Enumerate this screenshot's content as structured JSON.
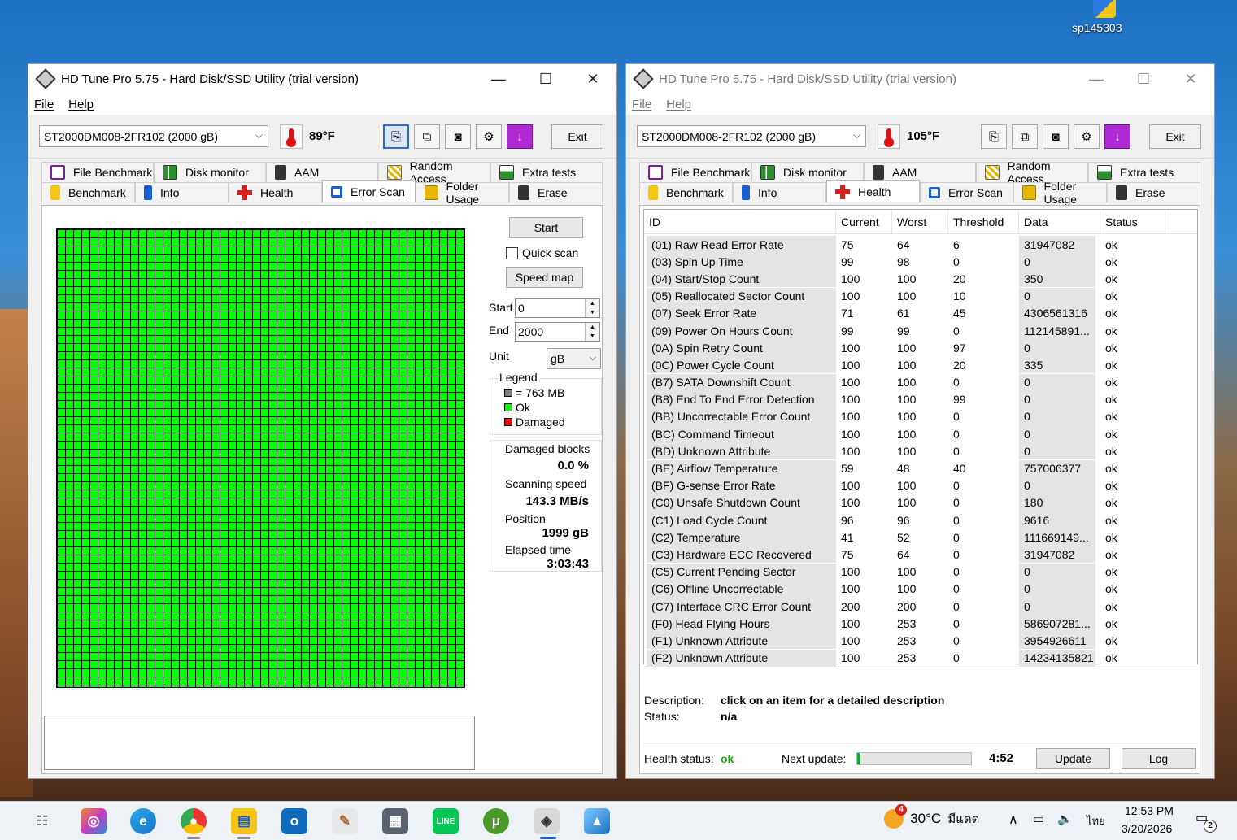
{
  "desktop": {
    "icon_label": "sp145303"
  },
  "left_window": {
    "title": "HD Tune Pro 5.75 - Hard Disk/SSD Utility (trial version)",
    "menu": [
      "File",
      "Help"
    ],
    "drive": "ST2000DM008-2FR102 (2000 gB)",
    "temperature": "89°F",
    "exit_label": "Exit",
    "tabs_row1": [
      "File Benchmark",
      "Disk monitor",
      "AAM",
      "Random Access",
      "Extra tests"
    ],
    "tabs_row2": [
      "Benchmark",
      "Info",
      "Health",
      "Error Scan",
      "Folder Usage",
      "Erase"
    ],
    "active_tab": "Error Scan",
    "error_scan": {
      "start_button": "Start",
      "quick_scan_label": "Quick scan",
      "speed_map_button": "Speed map",
      "start_label": "Start",
      "start_value": "0",
      "end_label": "End",
      "end_value": "2000",
      "unit_label": "Unit",
      "unit_value": "gB",
      "legend_title": "Legend",
      "legend_block": "= 763 MB",
      "legend_ok": "Ok",
      "legend_damaged": "Damaged",
      "damaged_blocks_label": "Damaged blocks",
      "damaged_blocks_value": "0.0 %",
      "scanning_speed_label": "Scanning speed",
      "scanning_speed_value": "143.3 MB/s",
      "position_label": "Position",
      "position_value": "1999 gB",
      "elapsed_label": "Elapsed time",
      "elapsed_value": "3:03:43"
    }
  },
  "right_window": {
    "title": "HD Tune Pro 5.75 - Hard Disk/SSD Utility (trial version)",
    "menu": [
      "File",
      "Help"
    ],
    "drive": "ST2000DM008-2FR102 (2000 gB)",
    "temperature": "105°F",
    "exit_label": "Exit",
    "tabs_row1": [
      "File Benchmark",
      "Disk monitor",
      "AAM",
      "Random Access",
      "Extra tests"
    ],
    "tabs_row2": [
      "Benchmark",
      "Info",
      "Health",
      "Error Scan",
      "Folder Usage",
      "Erase"
    ],
    "active_tab": "Health",
    "health": {
      "columns": [
        "ID",
        "Current",
        "Worst",
        "Threshold",
        "Data",
        "Status"
      ],
      "rows": [
        [
          "(01) Raw Read Error Rate",
          "75",
          "64",
          "6",
          "31947082",
          "ok"
        ],
        [
          "(03) Spin Up Time",
          "99",
          "98",
          "0",
          "0",
          "ok"
        ],
        [
          "(04) Start/Stop Count",
          "100",
          "100",
          "20",
          "350",
          "ok"
        ],
        [
          "(05) Reallocated Sector Count",
          "100",
          "100",
          "10",
          "0",
          "ok"
        ],
        [
          "(07) Seek Error Rate",
          "71",
          "61",
          "45",
          "4306561316",
          "ok"
        ],
        [
          "(09) Power On Hours Count",
          "99",
          "99",
          "0",
          "112145891...",
          "ok"
        ],
        [
          "(0A) Spin Retry Count",
          "100",
          "100",
          "97",
          "0",
          "ok"
        ],
        [
          "(0C) Power Cycle Count",
          "100",
          "100",
          "20",
          "335",
          "ok"
        ],
        [
          "(B7) SATA Downshift Count",
          "100",
          "100",
          "0",
          "0",
          "ok"
        ],
        [
          "(B8) End To End Error Detection",
          "100",
          "100",
          "99",
          "0",
          "ok"
        ],
        [
          "(BB) Uncorrectable Error Count",
          "100",
          "100",
          "0",
          "0",
          "ok"
        ],
        [
          "(BC) Command Timeout",
          "100",
          "100",
          "0",
          "0",
          "ok"
        ],
        [
          "(BD) Unknown Attribute",
          "100",
          "100",
          "0",
          "0",
          "ok"
        ],
        [
          "(BE) Airflow Temperature",
          "59",
          "48",
          "40",
          "757006377",
          "ok"
        ],
        [
          "(BF) G-sense Error Rate",
          "100",
          "100",
          "0",
          "0",
          "ok"
        ],
        [
          "(C0) Unsafe Shutdown Count",
          "100",
          "100",
          "0",
          "180",
          "ok"
        ],
        [
          "(C1) Load Cycle Count",
          "96",
          "96",
          "0",
          "9616",
          "ok"
        ],
        [
          "(C2) Temperature",
          "41",
          "52",
          "0",
          "111669149...",
          "ok"
        ],
        [
          "(C3) Hardware ECC Recovered",
          "75",
          "64",
          "0",
          "31947082",
          "ok"
        ],
        [
          "(C5) Current Pending Sector",
          "100",
          "100",
          "0",
          "0",
          "ok"
        ],
        [
          "(C6) Offline Uncorrectable",
          "100",
          "100",
          "0",
          "0",
          "ok"
        ],
        [
          "(C7) Interface CRC Error Count",
          "200",
          "200",
          "0",
          "0",
          "ok"
        ],
        [
          "(F0) Head Flying Hours",
          "100",
          "253",
          "0",
          "586907281...",
          "ok"
        ],
        [
          "(F1) Unknown Attribute",
          "100",
          "253",
          "0",
          "3954926611",
          "ok"
        ],
        [
          "(F2) Unknown Attribute",
          "100",
          "253",
          "0",
          "14234135821",
          "ok"
        ]
      ],
      "description_label": "Description:",
      "description_value": "click on an item for a detailed description",
      "status_label": "Status:",
      "status_value": "n/a",
      "health_status_label": "Health status:",
      "health_status_value": "ok",
      "next_update_label": "Next update:",
      "next_update_progress": 0.02,
      "next_update_time": "4:52",
      "update_button": "Update",
      "log_button": "Log"
    }
  },
  "taskbar": {
    "weather_badge": "4",
    "weather_temp": "30°C",
    "weather_text": "มีแดด",
    "language": "ไทย",
    "time": "12:53 PM",
    "date": "3/20/2026",
    "notification_count": "2"
  }
}
